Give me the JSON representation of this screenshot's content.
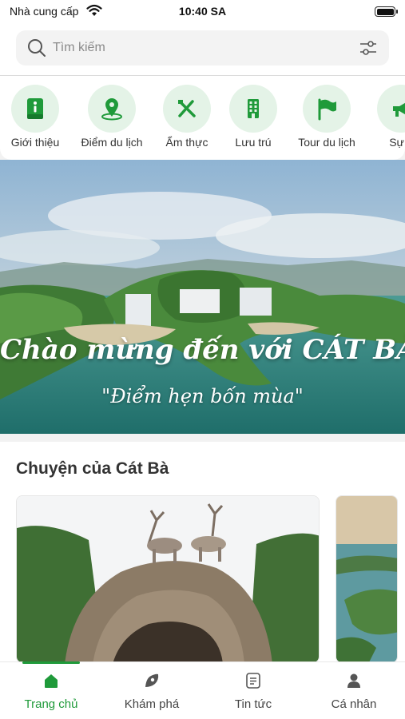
{
  "status_bar": {
    "carrier": "Nhà cung cấp",
    "time": "10:40 SA",
    "battery_level": 1.0
  },
  "search": {
    "placeholder": "Tìm kiếm",
    "value": "",
    "icon": "search-icon",
    "filter_icon": "sliders-icon"
  },
  "categories": [
    {
      "label": "Giới thiệu",
      "icon": "info-book-icon"
    },
    {
      "label": "Điểm du lịch",
      "icon": "map-pin-icon"
    },
    {
      "label": "Ẩm thực",
      "icon": "fork-knife-icon"
    },
    {
      "label": "Lưu trú",
      "icon": "building-icon"
    },
    {
      "label": "Tour du lịch",
      "icon": "flag-icon"
    },
    {
      "label": "Sự k",
      "icon": "megaphone-icon"
    }
  ],
  "banner": {
    "title": "Chào mừng đến với CÁT BÀ",
    "subtitle": "\"Điểm hẹn bốn mùa\""
  },
  "stories": {
    "title": "Chuyện của Cát Bà"
  },
  "tabbar": {
    "items": [
      {
        "label": "Trang chủ",
        "icon": "home-icon",
        "active": true
      },
      {
        "label": "Khám phá",
        "icon": "compass-icon",
        "active": false
      },
      {
        "label": "Tin tức",
        "icon": "news-icon",
        "active": false
      },
      {
        "label": "Cá nhân",
        "icon": "user-icon",
        "active": false
      }
    ]
  },
  "colors": {
    "accent": "#1f9a3a",
    "icon_bg": "#e4f3e7"
  }
}
